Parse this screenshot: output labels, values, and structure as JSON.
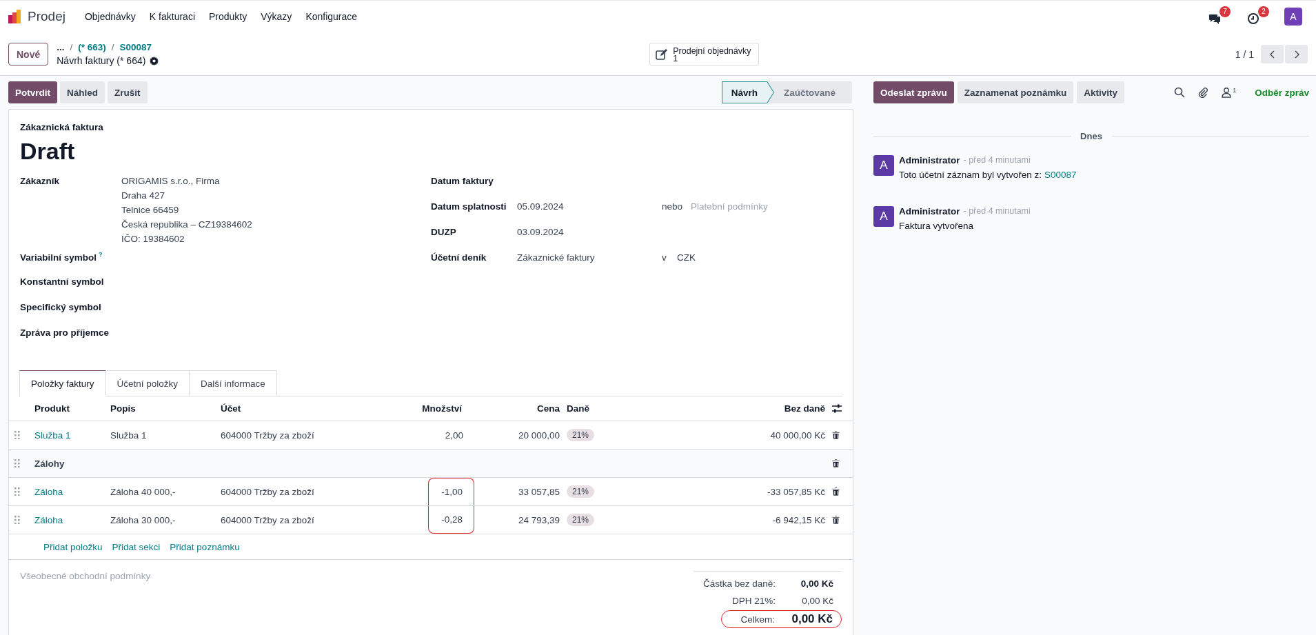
{
  "navbar": {
    "app_name": "Prodej",
    "menu": [
      "Objednávky",
      "K fakturaci",
      "Produkty",
      "Výkazy",
      "Konfigurace"
    ],
    "messages_count": "7",
    "activities_count": "2",
    "avatar": "A"
  },
  "breadcrumb": {
    "new_button": "Nové",
    "more": "...",
    "items": [
      {
        "separator": "/",
        "label": "(* 663)"
      },
      {
        "separator": "/",
        "label": "S00087"
      }
    ],
    "current": "Návrh faktury (* 664)"
  },
  "smart_button": {
    "label": "Prodejní objednávky",
    "count": "1"
  },
  "pager": {
    "value": "1 / 1"
  },
  "actions": [
    {
      "label": "Potvrdit",
      "primary": true
    },
    {
      "label": "Náhled",
      "primary": false
    },
    {
      "label": "Zrušit",
      "primary": false
    }
  ],
  "statusbar": [
    {
      "label": "Návrh",
      "selected": true
    },
    {
      "label": "Zaúčtované",
      "selected": false
    }
  ],
  "form": {
    "subtitle": "Zákaznická faktura",
    "title": "Draft",
    "left_fields": [
      {
        "label": "Zákazník",
        "lines": [
          "ORIGAMIS s.r.o., Firma",
          "Draha 427",
          "Telnice 66459",
          "Česká republika – CZ19384602",
          "IČO: 19384602"
        ]
      },
      {
        "label": "Variabilní symbol",
        "help": "?"
      },
      {
        "label": "Konstantní symbol"
      },
      {
        "label": "Specifický symbol"
      },
      {
        "label": "Zpráva pro příjemce"
      }
    ],
    "right_fields": [
      {
        "label": "Datum faktury"
      },
      {
        "label": "Datum splatnosti",
        "value": "05.09.2024",
        "connector": "nebo",
        "placeholder": "Platební podmínky"
      },
      {
        "label": "DUZP",
        "value": "03.09.2024"
      },
      {
        "label": "Účetní deník",
        "value": "Zákaznické faktury",
        "connector": "v",
        "extra": "CZK"
      }
    ]
  },
  "tabs": [
    {
      "label": "Položky faktury",
      "selected": true
    },
    {
      "label": "Účetní položky",
      "selected": false
    },
    {
      "label": "Další informace",
      "selected": false
    }
  ],
  "table": {
    "columns": [
      "Produkt",
      "Popis",
      "Účet",
      "Množství",
      "Cena",
      "Daně",
      "Bez daně"
    ],
    "rows": [
      {
        "kind": "line",
        "product": "Služba 1",
        "description": "Služba 1",
        "account": "604000 Tržby za zboží",
        "quantity": "2,00",
        "price": "20 000,00",
        "tax": "21%",
        "subtotal": "40 000,00 Kč",
        "highlighted": false
      },
      {
        "kind": "section",
        "label": "Zálohy"
      },
      {
        "kind": "line",
        "product": "Záloha",
        "description": "Záloha 40 000,-",
        "account": "604000 Tržby za zboží",
        "quantity": "-1,00",
        "price": "33 057,85",
        "tax": "21%",
        "subtotal": "-33 057,85 Kč",
        "highlighted": true
      },
      {
        "kind": "line",
        "product": "Záloha",
        "description": "Záloha 30 000,-",
        "account": "604000 Tržby za zboží",
        "quantity": "-0,28",
        "price": "24 793,39",
        "tax": "21%",
        "subtotal": "-6 942,15 Kč",
        "highlighted": true
      }
    ]
  },
  "add_links": [
    "Přidat položku",
    "Přidat sekci",
    "Přidat poznámku"
  ],
  "terms_placeholder": "Všeobecné obchodní podmínky",
  "totals": [
    {
      "kind": "subtotal",
      "label": "Částka bez daně:",
      "value": "0,00 Kč",
      "highlighted": false
    },
    {
      "kind": "tax",
      "label": "DPH 21%:",
      "value": "0,00 Kč",
      "highlighted": false
    },
    {
      "kind": "total",
      "label": "Celkem:",
      "value": "0,00 Kč",
      "highlighted": true
    }
  ],
  "chatter": {
    "buttons": [
      {
        "label": "Odeslat zprávu",
        "primary": true
      },
      {
        "label": "Zaznamenat poznámku",
        "primary": false
      },
      {
        "label": "Aktivity",
        "primary": false
      }
    ],
    "follower_count": "1",
    "follow": "Odběr zpráv",
    "date_separator": "Dnes",
    "messages": [
      {
        "avatar": "A",
        "author": "Administrator",
        "time": "- před 4 minutami",
        "body": "Toto účetní záznam byl vytvořen z:",
        "link": "S00087"
      },
      {
        "avatar": "A",
        "author": "Administrator",
        "time": "- před 4 minutami",
        "body": "Faktura vytvořena"
      }
    ]
  }
}
